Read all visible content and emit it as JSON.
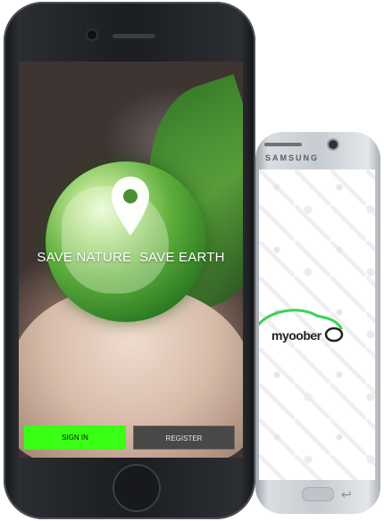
{
  "back_device": {
    "brand": "SAMSUNG",
    "logo_text": "myoober",
    "accent_color": "#39d353"
  },
  "front_device": {
    "headline": "SAVE NATURE  SAVE EARTH",
    "buttons": {
      "sign_in": "SIGN IN",
      "register": "REGISTER"
    },
    "colors": {
      "sign_in_bg": "#39ff14",
      "register_bg": "#4a4846"
    }
  },
  "icons": [
    "location-pin-icon",
    "back-arrow-icon",
    "home-button-icon"
  ]
}
